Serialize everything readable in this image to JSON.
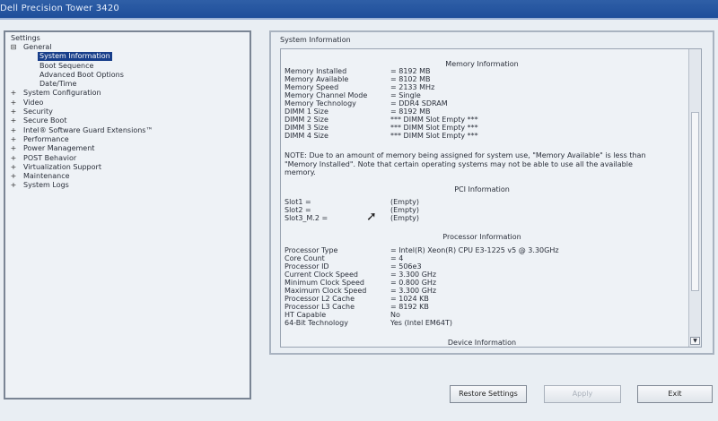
{
  "window": {
    "title": "Dell Precision Tower 3420"
  },
  "left_panel": {
    "group_label": "Settings",
    "items": [
      {
        "label": "General",
        "expander": "⊟",
        "child": false,
        "selected": false
      },
      {
        "label": "System Information",
        "expander": "",
        "child": true,
        "selected": true
      },
      {
        "label": "Boot Sequence",
        "expander": "",
        "child": true,
        "selected": false
      },
      {
        "label": "Advanced Boot Options",
        "expander": "",
        "child": true,
        "selected": false
      },
      {
        "label": "Date/Time",
        "expander": "",
        "child": true,
        "selected": false
      },
      {
        "label": "System Configuration",
        "expander": "+",
        "child": false,
        "selected": false
      },
      {
        "label": "Video",
        "expander": "+",
        "child": false,
        "selected": false
      },
      {
        "label": "Security",
        "expander": "+",
        "child": false,
        "selected": false
      },
      {
        "label": "Secure Boot",
        "expander": "+",
        "child": false,
        "selected": false
      },
      {
        "label": "Intel® Software Guard Extensions™",
        "expander": "+",
        "child": false,
        "selected": false
      },
      {
        "label": "Performance",
        "expander": "+",
        "child": false,
        "selected": false
      },
      {
        "label": "Power Management",
        "expander": "+",
        "child": false,
        "selected": false
      },
      {
        "label": "POST Behavior",
        "expander": "+",
        "child": false,
        "selected": false
      },
      {
        "label": "Virtualization Support",
        "expander": "+",
        "child": false,
        "selected": false
      },
      {
        "label": "Maintenance",
        "expander": "+",
        "child": false,
        "selected": false
      },
      {
        "label": "System Logs",
        "expander": "+",
        "child": false,
        "selected": false
      }
    ]
  },
  "right_panel": {
    "group_label": "System Information",
    "memory_title": "Memory Information",
    "memory": [
      {
        "key": "Memory Installed",
        "value": "= 8192 MB"
      },
      {
        "key": "Memory Available",
        "value": "= 8102 MB"
      },
      {
        "key": "Memory Speed",
        "value": "= 2133 MHz"
      },
      {
        "key": "Memory Channel Mode",
        "value": "= Single"
      },
      {
        "key": "Memory Technology",
        "value": "= DDR4 SDRAM"
      },
      {
        "key": "DIMM 1 Size",
        "value": "= 8192 MB"
      },
      {
        "key": "DIMM 2 Size",
        "value": "*** DIMM Slot Empty ***"
      },
      {
        "key": "DIMM 3 Size",
        "value": "*** DIMM Slot Empty ***"
      },
      {
        "key": "DIMM 4 Size",
        "value": "*** DIMM Slot Empty ***"
      }
    ],
    "note": "NOTE: Due to an amount of memory being assigned for system use, \"Memory Available\" is less than \"Memory Installed\". Note that certain operating systems may not be able to use all the available memory.",
    "pci_title": "PCI Information",
    "pci": [
      {
        "key": "Slot1 =",
        "value": "(Empty)"
      },
      {
        "key": "Slot2 =",
        "value": "(Empty)"
      },
      {
        "key": "Slot3_M.2 =",
        "value": "(Empty)"
      }
    ],
    "processor_title": "Processor Information",
    "processor": [
      {
        "key": "Processor Type",
        "value": "= Intel(R) Xeon(R) CPU E3-1225 v5 @ 3.30GHz"
      },
      {
        "key": "Core Count",
        "value": "= 4"
      },
      {
        "key": "Processor ID",
        "value": "= 506e3"
      },
      {
        "key": "Current Clock Speed",
        "value": "= 3.300 GHz"
      },
      {
        "key": "Minimum Clock Speed",
        "value": "= 0.800 GHz"
      },
      {
        "key": "Maximum Clock Speed",
        "value": "= 3.300 GHz"
      },
      {
        "key": "Processor L2 Cache",
        "value": "= 1024 KB"
      },
      {
        "key": "Processor L3 Cache",
        "value": "= 8192 KB"
      },
      {
        "key": "HT Capable",
        "value": "No"
      },
      {
        "key": "64-Bit Technology",
        "value": "Yes (Intel EM64T)"
      }
    ],
    "device_title": "Device Information"
  },
  "buttons": {
    "restore": "Restore Settings",
    "apply": "Apply",
    "exit": "Exit"
  },
  "icons": {
    "cursor": "mouse-cursor-icon",
    "scroll_down": "scroll-down-arrow-icon"
  }
}
